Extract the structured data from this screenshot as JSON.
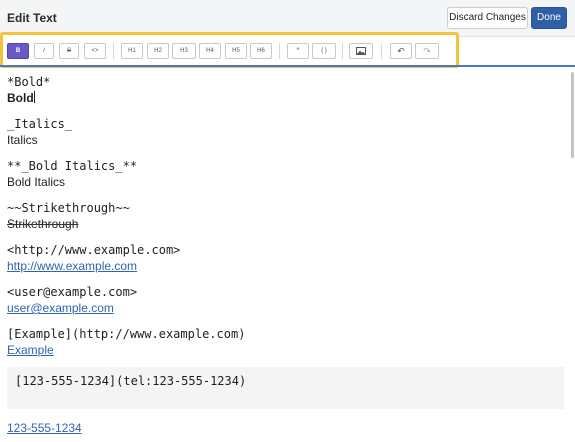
{
  "header": {
    "title": "Edit Text",
    "discard_label": "Discard Changes",
    "done_label": "Done"
  },
  "toolbar": {
    "buttons": [
      {
        "id": "bold",
        "label": "B",
        "active": true,
        "icon": "bold-icon"
      },
      {
        "id": "italic",
        "label": "I",
        "icon": "italic-icon"
      },
      {
        "id": "strike",
        "label": "S",
        "icon": "strikethrough-icon"
      },
      {
        "id": "code",
        "label": "<>",
        "icon": "code-icon"
      },
      {
        "id": "h1",
        "label": "H1",
        "icon": "heading-1-icon"
      },
      {
        "id": "h2",
        "label": "H2",
        "icon": "heading-2-icon"
      },
      {
        "id": "h3",
        "label": "H3",
        "icon": "heading-3-icon"
      },
      {
        "id": "h4",
        "label": "H4",
        "icon": "heading-4-icon"
      },
      {
        "id": "h5",
        "label": "H5",
        "icon": "heading-5-icon"
      },
      {
        "id": "h6",
        "label": "H6",
        "icon": "heading-6-icon"
      },
      {
        "id": "quote",
        "label": "“",
        "icon": "quote-icon"
      },
      {
        "id": "codeblock",
        "label": "{ }",
        "icon": "code-block-icon"
      },
      {
        "id": "image",
        "label": "",
        "icon": "image-icon"
      },
      {
        "id": "undo",
        "label": "↶",
        "icon": "undo-icon"
      },
      {
        "id": "redo",
        "label": "↷",
        "icon": "redo-icon"
      }
    ],
    "highlight_color": "#f2c43a",
    "active_color": "#6c57c7"
  },
  "editor": {
    "bold_src": "*Bold*",
    "bold_preview": "Bold",
    "italics_src": "_Italics_",
    "italics_preview": "Italics",
    "bold_italics_src": "**_Bold Italics_**",
    "bold_italics_preview": "Bold Italics",
    "strike_src": "~~Strikethrough~~",
    "strike_preview": "Strikethrough",
    "url_src": "<http://www.example.com>",
    "url_preview": "http://www.example.com",
    "email_src": "<user@example.com>",
    "email_preview": "user@example.com",
    "link_src": "[Example](http://www.example.com)",
    "link_preview": "Example",
    "tel_src": "[123-555-1234](tel:123-555-1234)",
    "tel_preview": "123-555-1234",
    "link_color": "#2f63b3"
  }
}
